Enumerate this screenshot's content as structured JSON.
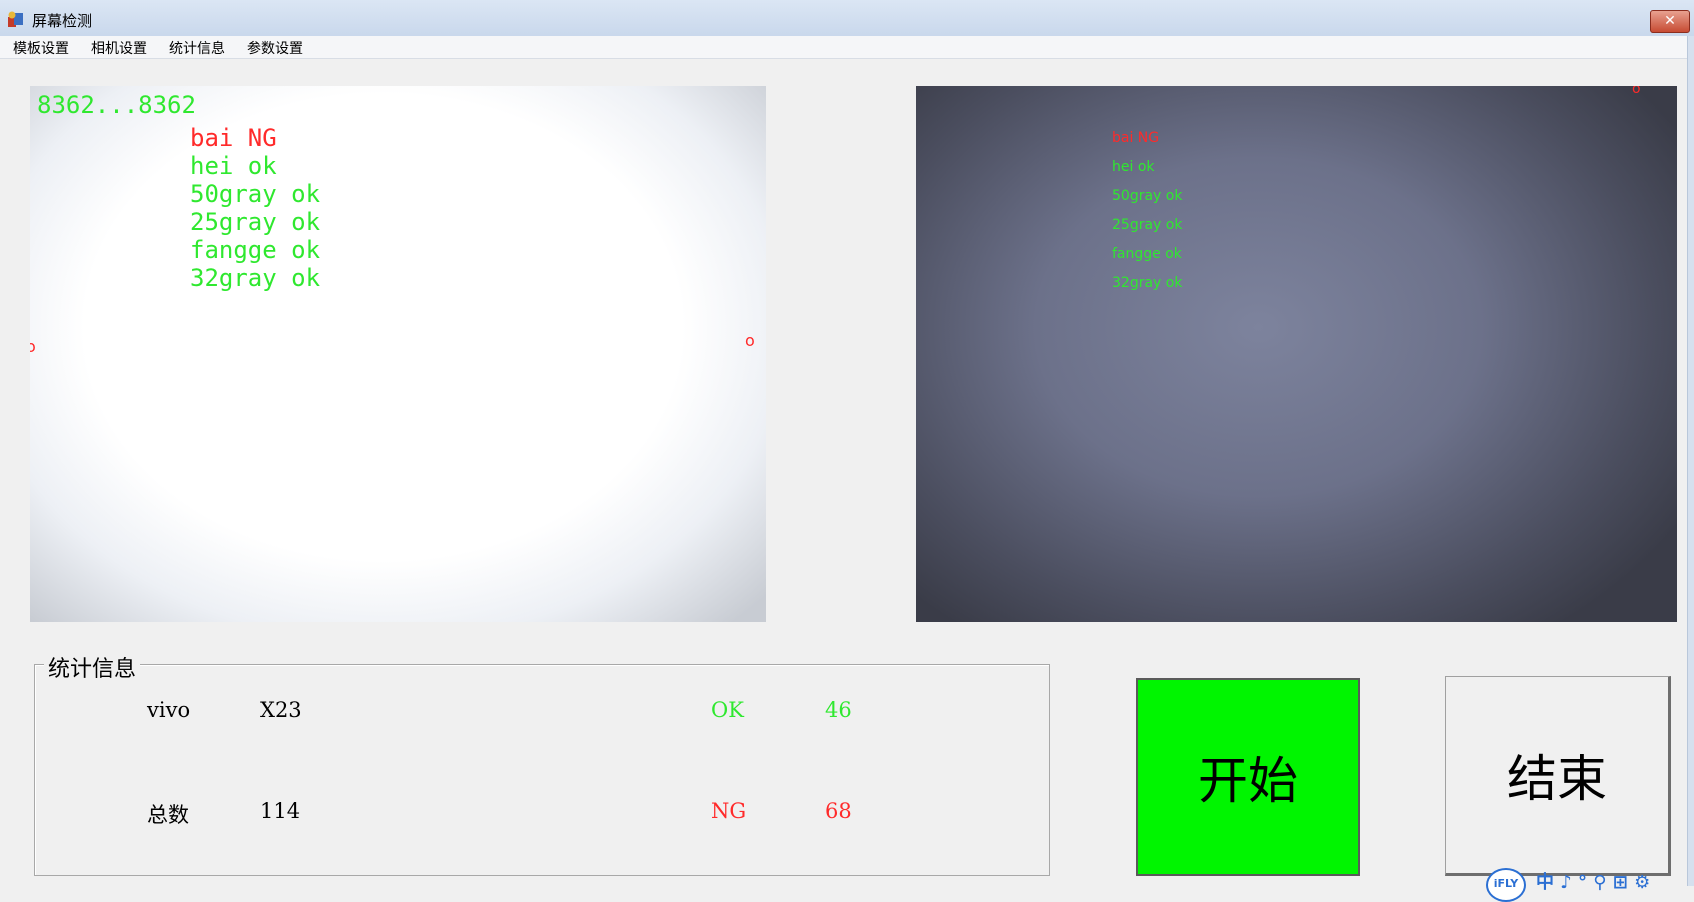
{
  "window": {
    "title": "屏幕检测",
    "close_label": "✕"
  },
  "menu": {
    "items": [
      "模板设置",
      "相机设置",
      "统计信息",
      "参数设置"
    ]
  },
  "left_view": {
    "counter": "8362...8362",
    "results": [
      {
        "text": "bai NG",
        "status": "ng"
      },
      {
        "text": "hei ok",
        "status": "ok"
      },
      {
        "text": "50gray ok",
        "status": "ok"
      },
      {
        "text": "25gray ok",
        "status": "ok"
      },
      {
        "text": "fangge ok",
        "status": "ok"
      },
      {
        "text": "32gray ok",
        "status": "ok"
      }
    ],
    "marks": [
      "o",
      "o"
    ]
  },
  "right_view": {
    "results": [
      {
        "text": "bai NG",
        "status": "ng"
      },
      {
        "text": "hei ok",
        "status": "ok"
      },
      {
        "text": "50gray ok",
        "status": "ok"
      },
      {
        "text": "25gray ok",
        "status": "ok"
      },
      {
        "text": "fangge ok",
        "status": "ok"
      },
      {
        "text": "32gray ok",
        "status": "ok"
      }
    ],
    "marks": [
      "o"
    ]
  },
  "stats": {
    "legend": "统计信息",
    "brand": "vivo",
    "model": "X23",
    "ok_label": "OK",
    "ok_count": "46",
    "total_label": "总数",
    "total_count": "114",
    "ng_label": "NG",
    "ng_count": "68"
  },
  "buttons": {
    "start": "开始",
    "end": "结束"
  },
  "ime": {
    "logo": "iFLY",
    "text": "中 ♪ ° ⚲ ⊞ ⚙"
  },
  "colors": {
    "ok": "#2fe82f",
    "ng": "#ff2a2a",
    "start_button": "#00f500"
  }
}
